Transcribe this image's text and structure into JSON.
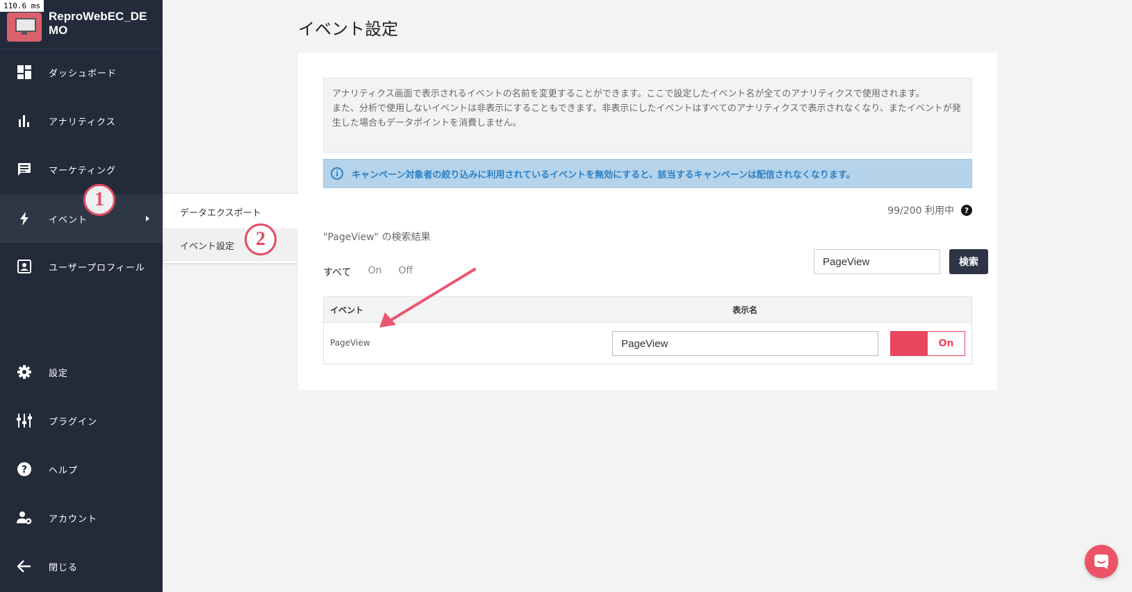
{
  "timing": "110.6 ms",
  "sidebar": {
    "brand": "ReproWebEC_DEMO",
    "items": [
      {
        "label": "ダッシュボード",
        "icon": "dashboard-icon"
      },
      {
        "label": "アナリティクス",
        "icon": "bar-chart-icon"
      },
      {
        "label": "マーケティング",
        "icon": "message-icon"
      },
      {
        "label": "イベント",
        "icon": "lightning-icon",
        "active": true
      },
      {
        "label": "ユーザープロフィール",
        "icon": "profile-icon"
      },
      {
        "label": "設定",
        "icon": "gear-icon"
      },
      {
        "label": "プラグイン",
        "icon": "plugin-icon"
      },
      {
        "label": "ヘルプ",
        "icon": "help-icon"
      },
      {
        "label": "アカウント",
        "icon": "account-icon"
      },
      {
        "label": "閉じる",
        "icon": "arrow-left-icon"
      }
    ]
  },
  "submenu": {
    "items": [
      {
        "label": "データエクスポート"
      },
      {
        "label": "イベント設定",
        "active": true
      }
    ]
  },
  "annotations": {
    "step1": "1",
    "step2": "2"
  },
  "main": {
    "title": "イベント設定",
    "description_line1": "アナリティクス画面で表示されるイベントの名前を変更することができます。ここで設定したイベント名が全てのアナリティクスで使用されます。",
    "description_line2": "また、分析で使用しないイベントは非表示にすることもできます。非表示にしたイベントはすべてのアナリティクスで表示されなくなり、またイベントが発生した場合もデータポイントを消費しません。",
    "info": "キャンペーン対象者の絞り込みに利用されているイベントを無効にすると、該当するキャンペーンは配信されなくなります。",
    "usage": "99/200 利用中",
    "results_label": "\"PageView\" の検索結果",
    "search_value": "PageView",
    "search_button": "検索",
    "filters": [
      "すべて",
      "On",
      "Off"
    ],
    "table": {
      "col_event": "イベント",
      "col_display": "表示名",
      "rows": [
        {
          "event": "PageView",
          "display": "PageView",
          "status": "On"
        }
      ]
    }
  },
  "colors": {
    "sidebar": "#232a3a",
    "accent": "#e8475f",
    "info": "#2a7fc6"
  }
}
